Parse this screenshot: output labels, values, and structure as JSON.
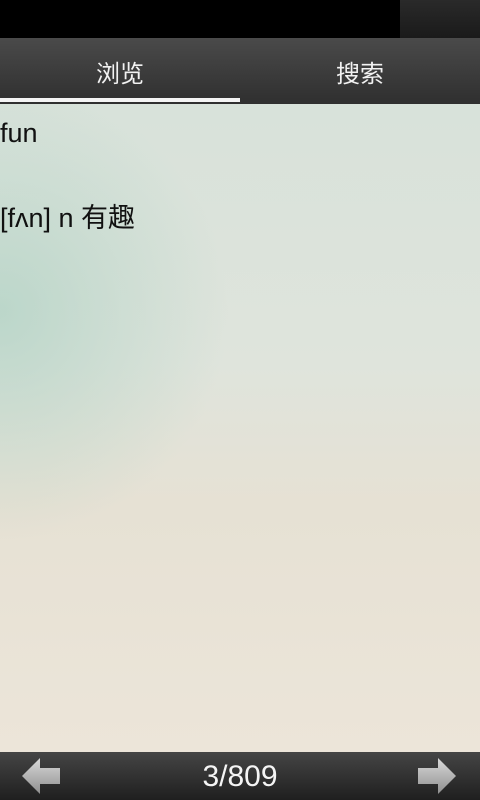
{
  "tabs": [
    {
      "label": "浏览",
      "active": true
    },
    {
      "label": "搜索",
      "active": false
    }
  ],
  "entry": {
    "word": "fun",
    "definition": "[fʌn] n 有趣"
  },
  "pager": {
    "indicator": "3/809",
    "current": 3,
    "total": 809
  },
  "icons": {
    "prev": "arrow-left-icon",
    "next": "arrow-right-icon"
  },
  "colors": {
    "tab_bar": "#3a3a3a",
    "active_underline": "#f4f4f4",
    "content_background": "#e4e4db",
    "text": "#111111"
  }
}
